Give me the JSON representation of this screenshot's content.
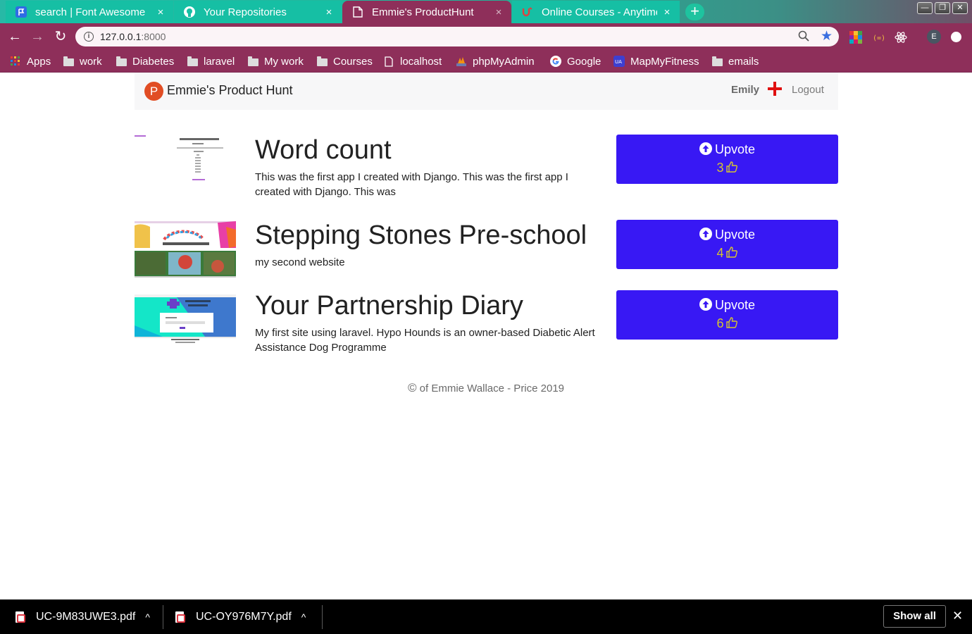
{
  "browser": {
    "tabs": [
      {
        "title": "search | Font Awesome",
        "icon": "font-awesome-flag-icon",
        "close": "×"
      },
      {
        "title": "Your Repositories",
        "icon": "github-icon",
        "close": "×"
      },
      {
        "title": "Emmie's ProductHunt",
        "icon": "page-icon",
        "close": "×"
      },
      {
        "title": "Online Courses - Anytime",
        "icon": "udemy-icon",
        "close": "×"
      }
    ],
    "new_tab": "+",
    "window_controls": {
      "minimize": "—",
      "restore": "❐",
      "close": "✕"
    },
    "toolbar": {
      "back": "←",
      "forward": "→",
      "reload": "↻"
    },
    "address": {
      "host": "127.0.0.1",
      "port": ":8000"
    },
    "profile_initial": "E",
    "bookmarks": [
      {
        "label": "Apps",
        "icon": "apps-grid-icon"
      },
      {
        "label": "work",
        "icon": "folder-icon"
      },
      {
        "label": "Diabetes",
        "icon": "folder-icon"
      },
      {
        "label": "laravel",
        "icon": "folder-icon"
      },
      {
        "label": "My work",
        "icon": "folder-icon"
      },
      {
        "label": "Courses",
        "icon": "folder-icon"
      },
      {
        "label": "localhost",
        "icon": "page-icon"
      },
      {
        "label": "phpMyAdmin",
        "icon": "phpmyadmin-icon"
      },
      {
        "label": "Google",
        "icon": "google-icon"
      },
      {
        "label": "MapMyFitness",
        "icon": "mapmyfitness-icon"
      },
      {
        "label": "emails",
        "icon": "folder-icon"
      }
    ]
  },
  "site": {
    "brand": {
      "logo_letter": "P",
      "name": "Emmie's Product Hunt"
    },
    "nav": {
      "user": "Emily",
      "logout": "Logout"
    },
    "upvote_label": "Upvote",
    "products": [
      {
        "title": "Word count",
        "description": "This was the first app I created with Django. This was the first app I created with Django. This was",
        "votes": "3"
      },
      {
        "title": "Stepping Stones Pre-school",
        "description": "my second website",
        "votes": "4"
      },
      {
        "title": "Your Partnership Diary",
        "description": "My first site using laravel. Hypo Hounds is an owner-based Diabetic Alert Assistance Dog Programme",
        "votes": "6"
      }
    ],
    "footer": {
      "symbol": "©",
      "text": "of Emmie Wallace - Price 2019"
    }
  },
  "downloads": {
    "files": [
      {
        "name": "UC-9M83UWE3.pdf",
        "chevron": "^"
      },
      {
        "name": "UC-OY976M7Y.pdf",
        "chevron": "^"
      }
    ],
    "show_all": "Show all",
    "close": "✕"
  },
  "colors": {
    "upvote_bg": "#3818f4",
    "vote_count": "#d5c431",
    "browser_frame": "#8e2f5a",
    "brand_logo": "#e14d24",
    "plus_icon": "#e01010"
  }
}
